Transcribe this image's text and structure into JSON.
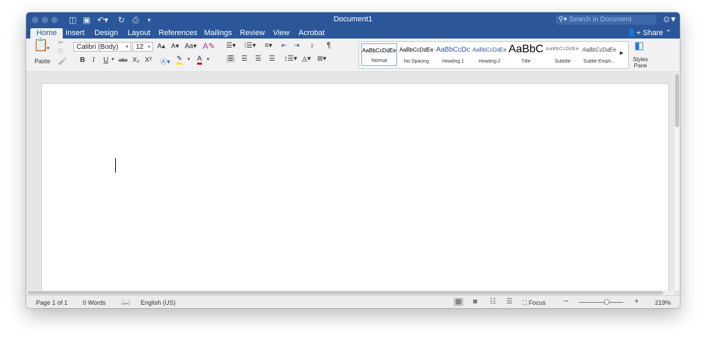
{
  "window": {
    "title": "Document1",
    "search_placeholder": "Search in Document",
    "quick_access": [
      "sidebar-icon",
      "save-icon",
      "undo-icon",
      "redo-icon",
      "print-icon",
      "customize-icon"
    ]
  },
  "tabs": [
    "Home",
    "Insert",
    "Design",
    "Layout",
    "References",
    "Mailings",
    "Review",
    "View",
    "Acrobat"
  ],
  "active_tab": "Home",
  "share_label": "Share",
  "ribbon": {
    "paste_label": "Paste",
    "font_name": "Calibri (Body)",
    "font_size": "12",
    "styles": [
      {
        "preview": "AaBbCcDdEe",
        "name": "Normal"
      },
      {
        "preview": "AaBbCcDdEe",
        "name": "No Spacing"
      },
      {
        "preview": "AaBbCcDc",
        "name": "Heading 1"
      },
      {
        "preview": "AaBbCcDdEe",
        "name": "Heading 2"
      },
      {
        "preview": "AaBbC",
        "name": "Title"
      },
      {
        "preview": "AaBbCcDdEe",
        "name": "Subtitle"
      },
      {
        "preview": "AaBbCcDdEe",
        "name": "Subtle Emph..."
      }
    ],
    "styles_pane_label": "Styles Pane",
    "colors": {
      "highlight": "#ffe200",
      "font_color": "#e00000",
      "accent": "#2b579a"
    }
  },
  "status": {
    "page": "Page 1 of 1",
    "words": "0 Words",
    "language": "English (US)",
    "focus_label": "Focus",
    "zoom": "219%"
  }
}
